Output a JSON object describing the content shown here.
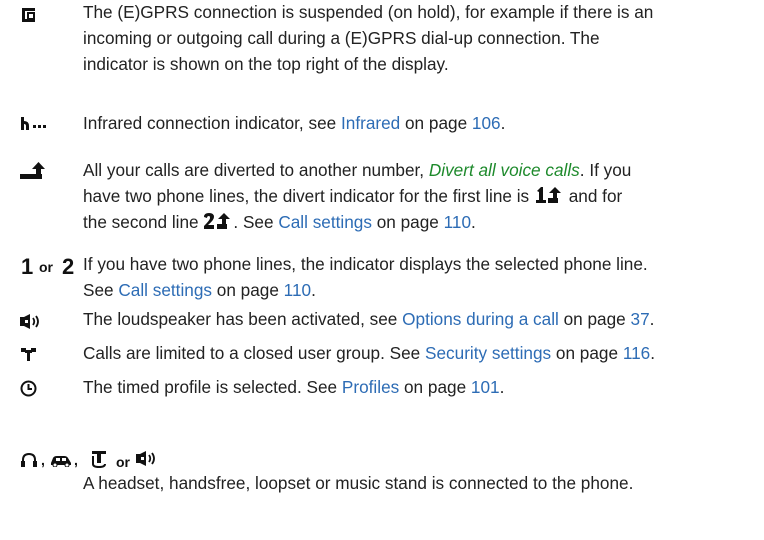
{
  "entries": {
    "egprs_hold": {
      "icon": "gprs-suspended-icon",
      "lines": [
        "The (E)GPRS connection is suspended (on hold), for example if there is an",
        "incoming or outgoing call during a (E)GPRS dial-up connection. The",
        "indicator is shown on the top right of the display."
      ]
    },
    "infrared": {
      "icon": "infrared-icon",
      "pre": "Infrared connection indicator, see ",
      "link": "Infrared",
      "mid": " on page ",
      "page": "106",
      "post": "."
    },
    "divert": {
      "icon": "divert-icon",
      "l1_pre": "All your calls are diverted to another number, ",
      "l1_link": "Divert all voice calls",
      "l1_post": ". If you",
      "l2_pre": "have two phone lines, the divert indicator for the first line is ",
      "l2_post": " and for",
      "l3_pre": "the second line ",
      "l3_mid": ". See ",
      "l3_link": "Call settings",
      "l3_on": " on page ",
      "l3_page": "110",
      "l3_post": "."
    },
    "lines": {
      "icon1": "1",
      "or": "or",
      "icon2": "2",
      "l1": "If you have two phone lines, the indicator displays the selected phone line.",
      "l2_pre": "See ",
      "l2_link": "Call settings",
      "l2_mid": " on page ",
      "l2_page": "110",
      "l2_post": "."
    },
    "loudspeaker": {
      "icon": "loudspeaker-icon",
      "pre": "The loudspeaker has been activated, see ",
      "link": "Options during a call",
      "mid": " on page ",
      "page": "37",
      "post": "."
    },
    "cug": {
      "icon": "closed-user-group-icon",
      "pre": "Calls are limited to a closed user group. See ",
      "link": "Security settings",
      "mid": " on page ",
      "page": "116",
      "post": "."
    },
    "timed": {
      "icon": "clock-icon",
      "pre": "The timed profile is selected. See ",
      "link": "Profiles",
      "mid": " on page ",
      "page": "101",
      "post": "."
    },
    "accessories": {
      "sep1": ",",
      "sep2": ",",
      "or": "or",
      "text": "A headset, handsfree, loopset or music stand is connected to the phone."
    }
  },
  "colors": {
    "link": "#2d6cb5",
    "emphasis": "#1e8a2c",
    "text": "#222222"
  }
}
